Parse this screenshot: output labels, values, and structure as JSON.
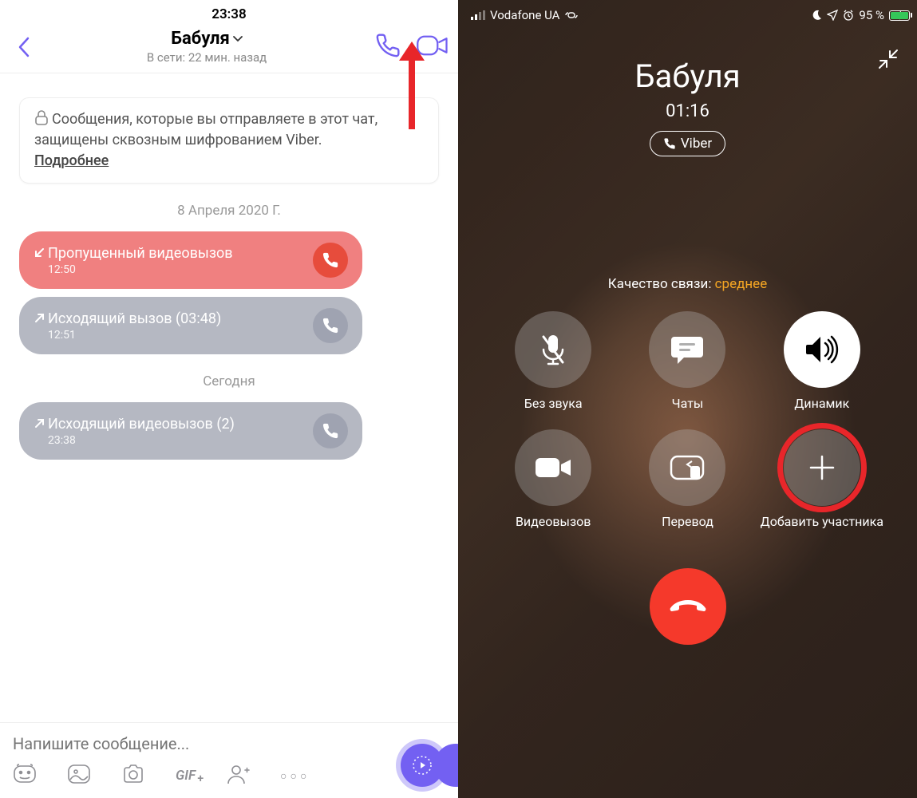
{
  "left": {
    "status_time": "23:38",
    "contact": "Бабуля",
    "online": "В сети: 22 мин. назад",
    "encryption": "Сообщения, которые вы отправляете в этот чат, защищены сквозным шифрованием Viber.",
    "encryption_more": "Подробнее",
    "date1": "8 Апреля 2020 Г.",
    "calls": [
      {
        "title": "Пропущенный видеовызов",
        "time": "12:50"
      },
      {
        "title": "Исходящий вызов (03:48)",
        "time": "12:51"
      }
    ],
    "date2": "Сегодня",
    "call_today": {
      "title": "Исходящий видеовызов (2)",
      "time": "23:38"
    },
    "input_placeholder": "Напишите сообщение..."
  },
  "right": {
    "carrier": "Vodafone UA",
    "battery": "95 %",
    "contact": "Бабуля",
    "timer": "01:16",
    "app": "Viber",
    "quality_label": "Качество связи: ",
    "quality_value": "среднее",
    "btns": {
      "mute": "Без звука",
      "chats": "Чаты",
      "speaker": "Динамик",
      "video": "Видеовызов",
      "transfer": "Перевод",
      "add": "Добавить участника"
    }
  }
}
